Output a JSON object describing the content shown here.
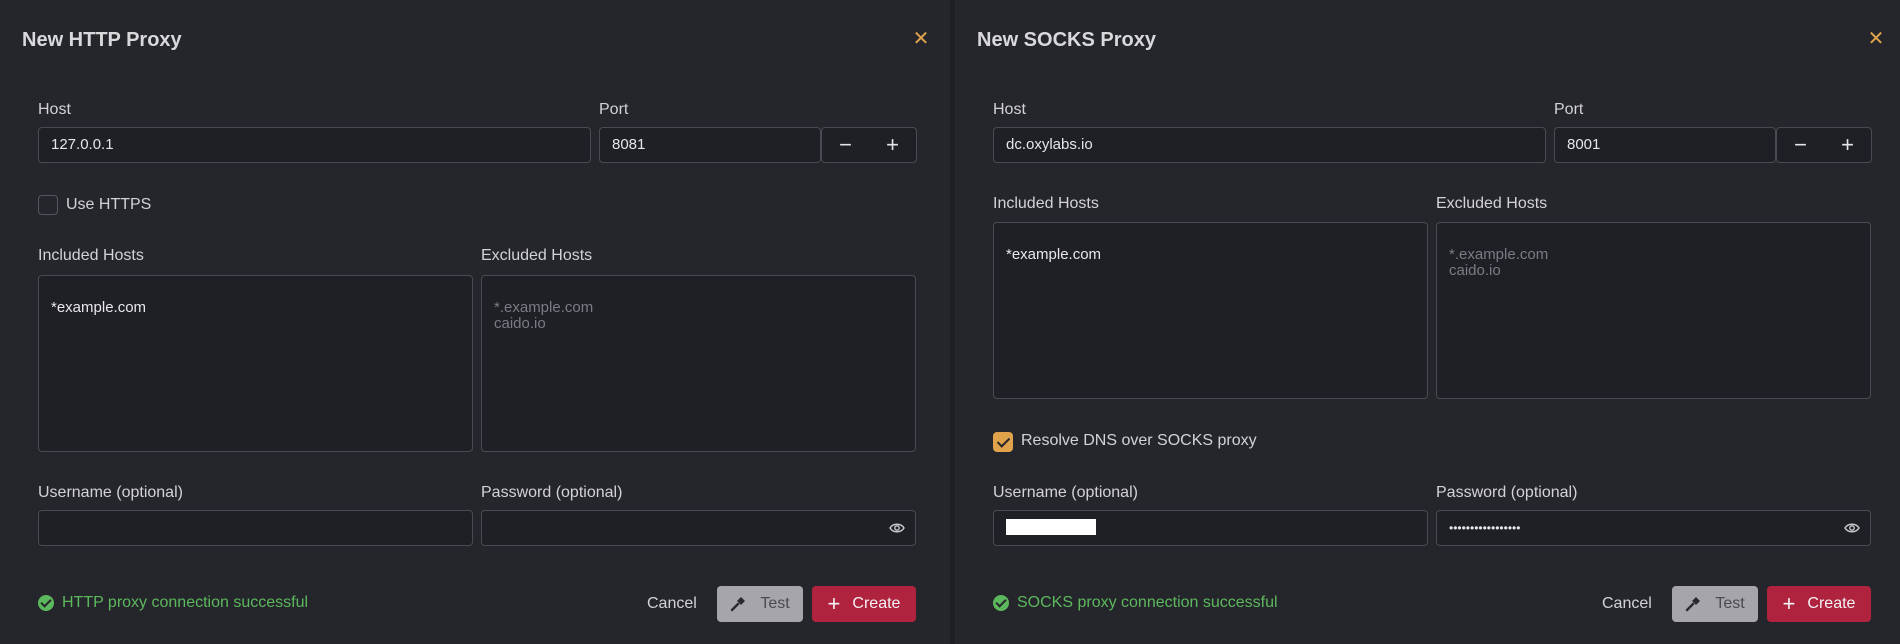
{
  "http": {
    "title": "New HTTP Proxy",
    "close_icon": "close-icon",
    "host_label": "Host",
    "host_value": "127.0.0.1",
    "port_label": "Port",
    "port_value": "8081",
    "minus": "−",
    "plus": "+",
    "use_https_label": "Use HTTPS",
    "use_https_checked": false,
    "included_label": "Included Hosts",
    "included_value": "*example.com",
    "excluded_label": "Excluded Hosts",
    "excluded_placeholder": "*.example.com\ncaido.io",
    "username_label": "Username (optional)",
    "username_value": "",
    "password_label": "Password (optional)",
    "password_value": "",
    "status_text": "HTTP proxy connection successful",
    "cancel_label": "Cancel",
    "test_label": "Test",
    "create_label": "Create"
  },
  "socks": {
    "title": "New SOCKS Proxy",
    "close_icon": "close-icon",
    "host_label": "Host",
    "host_value": "dc.oxylabs.io",
    "port_label": "Port",
    "port_value": "8001",
    "minus": "−",
    "plus": "+",
    "included_label": "Included Hosts",
    "included_value": "*example.com",
    "excluded_label": "Excluded Hosts",
    "excluded_placeholder": "*.example.com\ncaido.io",
    "resolve_dns_label": "Resolve DNS over SOCKS proxy",
    "resolve_dns_checked": true,
    "username_label": "Username (optional)",
    "password_label": "Password (optional)",
    "password_value": "•••••••••••••••••",
    "status_text": "SOCKS proxy connection successful",
    "cancel_label": "Cancel",
    "test_label": "Test",
    "create_label": "Create"
  },
  "colors": {
    "accent": "#e0a24a",
    "success": "#5cb85c",
    "create": "#b0233f",
    "background": "#25262c"
  }
}
